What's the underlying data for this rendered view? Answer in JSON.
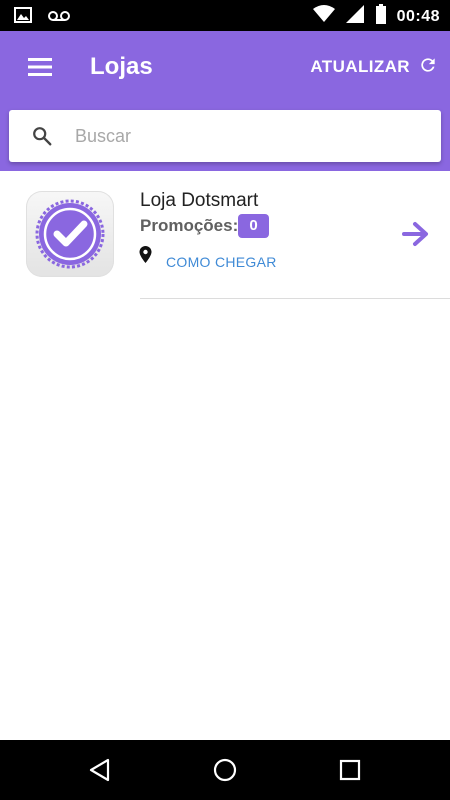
{
  "status_bar": {
    "time": "00:48",
    "left_icons": [
      "image-icon",
      "voicemail-icon"
    ],
    "right_icons": [
      "wifi-icon",
      "signal-icon",
      "battery-icon"
    ]
  },
  "app_bar": {
    "title": "Lojas",
    "menu_icon": "menu-icon",
    "refresh_label": "ATUALIZAR",
    "refresh_icon": "refresh-icon",
    "color": "#8a67e0"
  },
  "search": {
    "placeholder": "Buscar",
    "value": "",
    "icon": "search-icon"
  },
  "stores": [
    {
      "name": "Loja Dotsmart",
      "promotions_label": "Promoções:",
      "promotions_count": "0",
      "directions_label": "COMO CHEGAR",
      "logo_icon": "verified-badge-icon",
      "arrow_icon": "arrow-right-icon"
    }
  ],
  "nav_bar": {
    "icons": [
      "back-icon",
      "home-icon",
      "recents-icon"
    ]
  },
  "colors": {
    "accent": "#8a67e0",
    "link": "#3f8ad6",
    "badge": "#8a67e0"
  }
}
